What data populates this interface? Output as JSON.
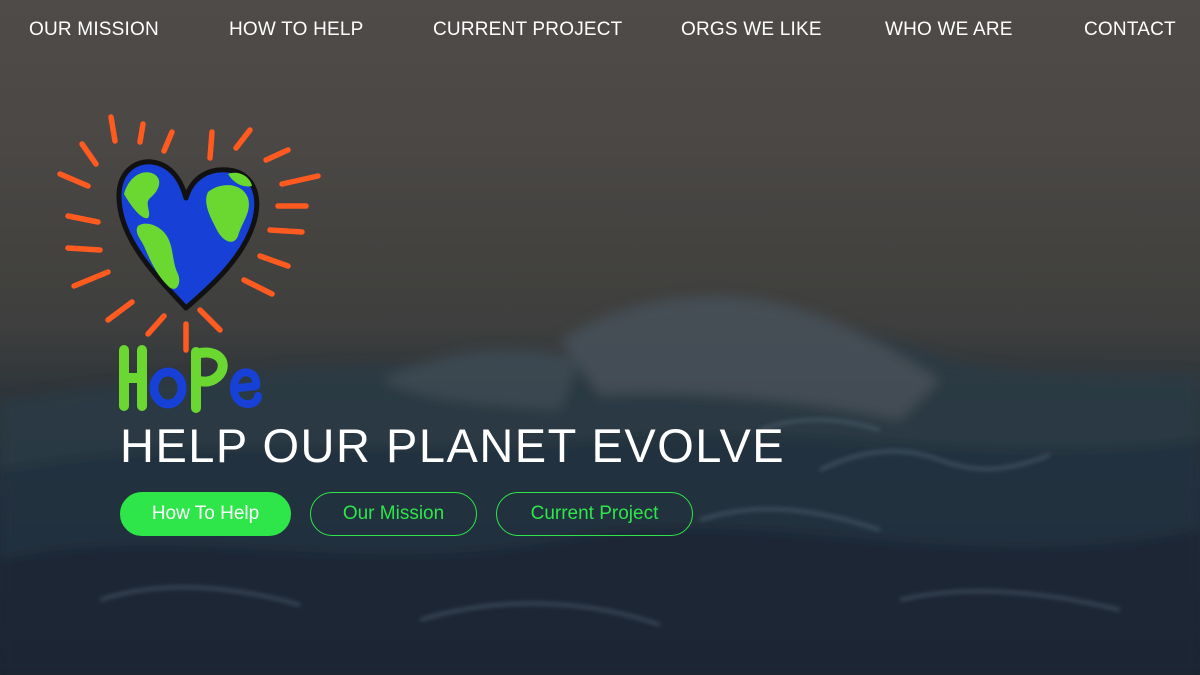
{
  "nav": {
    "items": [
      {
        "label": "OUR MISSION"
      },
      {
        "label": "HOW TO HELP"
      },
      {
        "label": "CURRENT PROJECT"
      },
      {
        "label": "ORGS WE LIKE"
      },
      {
        "label": "WHO WE ARE"
      },
      {
        "label": "CONTACT"
      }
    ]
  },
  "logo": {
    "wordmark": "HoPe",
    "icon": "heart-earth-icon"
  },
  "hero": {
    "tagline": "HELP OUR PLANET EVOLVE",
    "buttons": {
      "how_to_help": "How To Help",
      "our_mission": "Our Mission",
      "current_project": "Current Project"
    }
  },
  "colors": {
    "accent_green": "#2ee54a",
    "ray_orange": "#ff5a1f",
    "earth_blue": "#1740d6",
    "land_green": "#6ad830",
    "text_white": "#ffffff"
  }
}
